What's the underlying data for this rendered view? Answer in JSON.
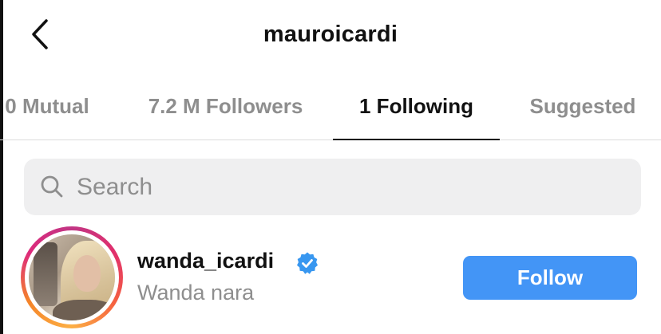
{
  "header": {
    "title": "mauroicardi",
    "back_icon": "chevron-left-icon"
  },
  "tabs": [
    {
      "label": "0 Mutual",
      "active": false
    },
    {
      "label": "7.2 M Followers",
      "active": false
    },
    {
      "label": "1 Following",
      "active": true
    },
    {
      "label": "Suggested",
      "active": false
    }
  ],
  "search": {
    "placeholder": "Search",
    "value": "",
    "icon": "search-icon"
  },
  "users": [
    {
      "username": "wanda_icardi",
      "full_name": "Wanda nara",
      "verified": true,
      "action_label": "Follow"
    }
  ],
  "colors": {
    "accent": "#4395f6",
    "verified": "#3897f0",
    "muted_text": "#8e8e8e",
    "search_bg": "#efeff0"
  }
}
